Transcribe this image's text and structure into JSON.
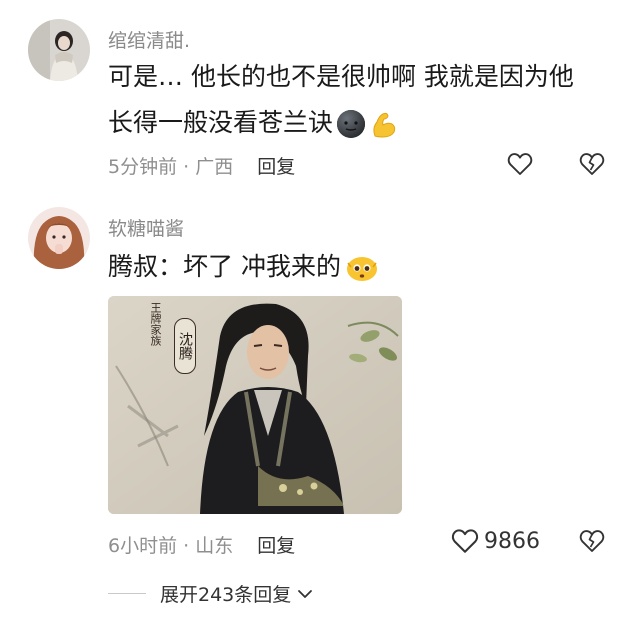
{
  "comments": [
    {
      "username": "绾绾清甜.",
      "text_line1": "可是… 他长的也不是很帅啊 我就是因为他",
      "text_line2": "长得一般没看苍兰诀",
      "time": "5分钟前 · 广西",
      "reply_label": "回复",
      "emojis": [
        "dark-moon-face-emoji",
        "flexed-biceps-emoji"
      ]
    },
    {
      "username": "软糖喵酱",
      "text": "腾叔：坏了 冲我来的",
      "emoji": "pleading-face-emoji",
      "time": "6小时前 · 山东",
      "reply_label": "回复",
      "like_count": "9866",
      "image": {
        "badge_small": "王牌家族",
        "badge_name": "沈腾"
      }
    }
  ],
  "expand_replies": "展开243条回复",
  "colors": {
    "meta": "#8f8f8f",
    "username": "#8a8a8a",
    "text": "#1a1a1a"
  }
}
